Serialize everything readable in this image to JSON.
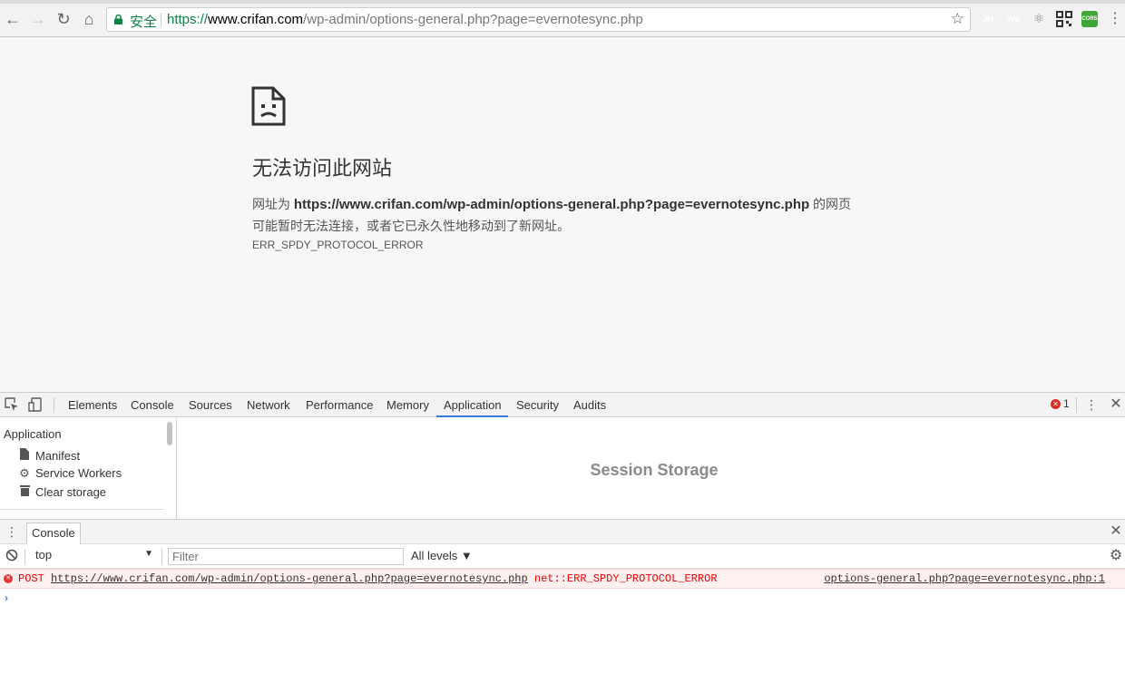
{
  "browser": {
    "secure_label": "安全",
    "url_scheme": "https://",
    "url_host": "www.crifan.com",
    "url_path": "/wp-admin/options-general.php?page=evernotesync.php",
    "extensions": [
      {
        "label": "JH",
        "color": "#4a6ee0"
      },
      {
        "label": "Wa",
        "color": "#6b6bdc"
      },
      {
        "label": "",
        "color": "#bbbbbb"
      },
      {
        "label": "",
        "color": "#333333"
      },
      {
        "label": "CORS",
        "color": "#3fa535"
      }
    ]
  },
  "error_page": {
    "title": "无法访问此网站",
    "line1_prefix": "网址为 ",
    "line1_url": "https://www.crifan.com/wp-admin/options-general.php?page=evernotesync.php",
    "line1_suffix": " 的网页",
    "line2": "可能暂时无法连接，或者它已永久性地移动到了新网址。",
    "error_code": "ERR_SPDY_PROTOCOL_ERROR"
  },
  "devtools": {
    "tabs": [
      "Elements",
      "Console",
      "Sources",
      "Network",
      "Performance",
      "Memory",
      "Application",
      "Security",
      "Audits"
    ],
    "active_tab": "Application",
    "error_count": "1",
    "sidebar": {
      "heading": "Application",
      "items": [
        {
          "label": "Manifest",
          "icon": "document-icon"
        },
        {
          "label": "Service Workers",
          "icon": "gear-icon"
        },
        {
          "label": "Clear storage",
          "icon": "trash-icon"
        }
      ]
    },
    "main_title": "Session Storage",
    "drawer": {
      "tab_label": "Console",
      "context": "top",
      "filter_placeholder": "Filter",
      "levels": "All levels ▼",
      "messages": [
        {
          "method": "POST",
          "url": "https://www.crifan.com/wp-admin/options-general.php?page=evernotesync.php",
          "error": "net::ERR_SPDY_PROTOCOL_ERROR",
          "source": "options-general.php?page=evernotesync.php:1"
        }
      ],
      "prompt": "›"
    }
  }
}
